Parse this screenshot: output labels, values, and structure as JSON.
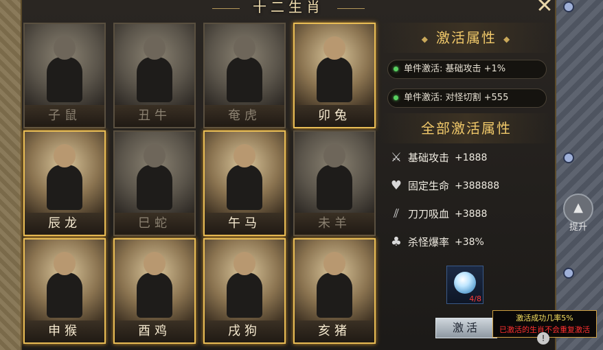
{
  "window": {
    "title": "十二生肖",
    "close_icon": "crossed-swords-close-icon"
  },
  "zodiac_cards": [
    {
      "name": "子鼠",
      "active": false
    },
    {
      "name": "丑牛",
      "active": false
    },
    {
      "name": "奄虎",
      "active": false
    },
    {
      "name": "卯兔",
      "active": true
    },
    {
      "name": "辰龙",
      "active": true
    },
    {
      "name": "巳蛇",
      "active": false
    },
    {
      "name": "午马",
      "active": true
    },
    {
      "name": "未羊",
      "active": false
    },
    {
      "name": "申猴",
      "active": true
    },
    {
      "name": "酉鸡",
      "active": true
    },
    {
      "name": "戌狗",
      "active": true
    },
    {
      "name": "亥猪",
      "active": true
    }
  ],
  "activation": {
    "title": "激活属性",
    "items": [
      {
        "label": "单件激活: 基础攻击 +1%"
      },
      {
        "label": "单件激活: 对怪切割 +555"
      }
    ]
  },
  "all_activation": {
    "title": "全部激活属性",
    "stats": [
      {
        "icon": "crossed-swords-icon",
        "name": "基础攻击",
        "value": "+1888"
      },
      {
        "icon": "heart-icon",
        "name": "固定生命",
        "value": "+388888"
      },
      {
        "icon": "claw-slash-icon",
        "name": "刀刀吸血",
        "value": "+3888"
      },
      {
        "icon": "clover-icon",
        "name": "杀怪爆率",
        "value": "+38%"
      }
    ]
  },
  "item_slot": {
    "count": "4/8",
    "icon": "diamond-gem-icon"
  },
  "activate_button": "激活",
  "tooltip": {
    "line1": "激活成功几率5%",
    "line2": "已激活的生肖不会重复激活"
  },
  "side": {
    "upgrade_label": "提升"
  },
  "colors": {
    "gold": "#e9bd55",
    "green": "#58d060",
    "red": "#ff3030",
    "tooltip_yellow": "#f6e060"
  }
}
